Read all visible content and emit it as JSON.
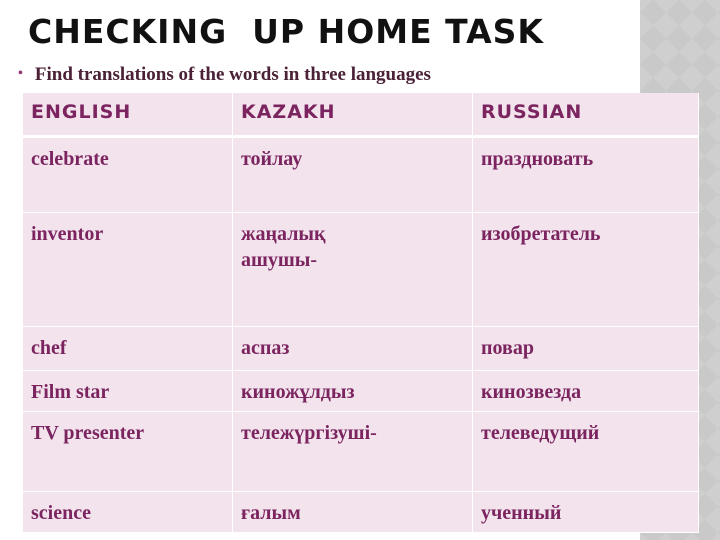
{
  "slide": {
    "title": "CHECKING  UP HOME TASK",
    "instruction": "Find translations of the words in three languages",
    "bullet": "•"
  },
  "table": {
    "headers": [
      "ENGLISH",
      "KAZAKH",
      "RUSSIAN"
    ],
    "rows": [
      [
        "celebrate",
        "тойлау",
        "праздновать"
      ],
      [
        "inventor",
        "жаңалық ашушы-",
        "изобретатель"
      ],
      [
        "chef",
        "аспаз",
        "повар"
      ],
      [
        "Film star",
        "киножұлдыз",
        "кинозвезда"
      ],
      [
        "TV presenter",
        "тележүргізуші-",
        "телеведущий"
      ],
      [
        "science",
        "ғалым",
        "ученный"
      ]
    ]
  },
  "colors": {
    "cell_background": "#f2e3ec",
    "header_text": "#7b2460",
    "cell_text": "#7b2460",
    "instruction_text": "#4a2136",
    "bullet": "#8e3b73",
    "side_panel": "#c9c9c9"
  }
}
